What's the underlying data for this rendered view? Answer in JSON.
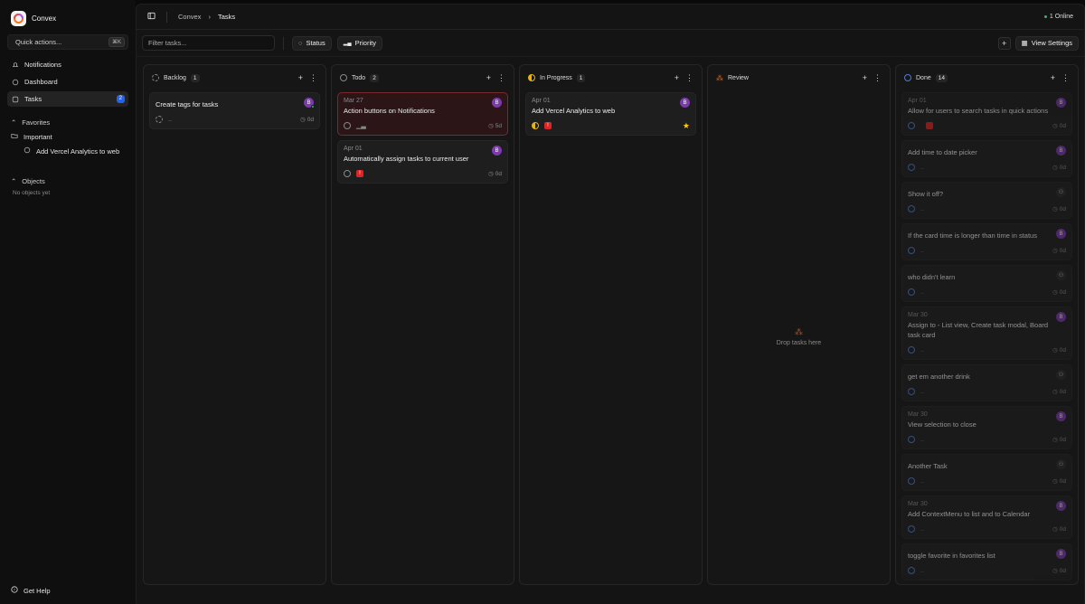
{
  "app": {
    "name": "Convex"
  },
  "sidebar": {
    "quick_actions": "Quick actions...",
    "quick_kbd": "⌘K",
    "nav": [
      {
        "label": "Notifications",
        "icon": "bell-icon"
      },
      {
        "label": "Dashboard",
        "icon": "dashboard-icon"
      },
      {
        "label": "Tasks",
        "icon": "tasks-icon",
        "badge": "2"
      }
    ],
    "favorites": {
      "label": "Favorites",
      "folder": "Important",
      "item": "Add Vercel Analytics to web"
    },
    "objects": {
      "label": "Objects",
      "empty": "No objects yet"
    },
    "help": "Get Help"
  },
  "topbar": {
    "crumb_root": "Convex",
    "crumb_current": "Tasks",
    "online": "1 Online"
  },
  "filterbar": {
    "placeholder": "Filter tasks...",
    "status": "Status",
    "priority": "Priority",
    "view_settings": "View Settings"
  },
  "columns": {
    "backlog": {
      "label": "Backlog",
      "count": "1"
    },
    "todo": {
      "label": "Todo",
      "count": "2"
    },
    "progress": {
      "label": "In Progress",
      "count": "1"
    },
    "review": {
      "label": "Review",
      "drop": "Drop tasks here"
    },
    "done": {
      "label": "Done",
      "count": "14"
    }
  },
  "cards": {
    "backlog": [
      {
        "title": "Create tags for tasks",
        "avatar": "B",
        "age": "0d"
      }
    ],
    "todo": [
      {
        "date": "Mar 27",
        "title": "Action buttons on Notifications",
        "avatar": "B",
        "age": "5d"
      },
      {
        "date": "Apr 01",
        "title": "Automatically assign tasks to current user",
        "avatar": "B",
        "age": "0d"
      }
    ],
    "progress": [
      {
        "date": "Apr 01",
        "title": "Add Vercel Analytics to web",
        "avatar": "B"
      }
    ],
    "done": [
      {
        "date": "Apr 01",
        "title": "Allow for users to search tasks in quick actions",
        "avatar": "B",
        "age": "0d"
      },
      {
        "date": "",
        "title": "Add time to date picker",
        "avatar": "B",
        "age": "0d"
      },
      {
        "date": "",
        "title": "Show it off?",
        "avatar": "",
        "age": "0d"
      },
      {
        "date": "",
        "title": "If the card time is longer than time in status",
        "avatar": "B",
        "age": "0d"
      },
      {
        "date": "",
        "title": "who didn't learn",
        "avatar": "",
        "age": "0d"
      },
      {
        "date": "Mar 30",
        "title": "Assign to - List view, Create task modal, Board task card",
        "avatar": "B",
        "age": "0d"
      },
      {
        "date": "",
        "title": "get em another drink",
        "avatar": "",
        "age": "0d"
      },
      {
        "date": "Mar 30",
        "title": "View selection to close",
        "avatar": "B",
        "age": "0d"
      },
      {
        "date": "",
        "title": "Another Task",
        "avatar": "",
        "age": "0d"
      },
      {
        "date": "Mar 30",
        "title": "Add ContextMenu to list and to Calendar",
        "avatar": "B",
        "age": "0d"
      },
      {
        "date": "",
        "title": "toggle favorite in favorites list",
        "avatar": "B",
        "age": "0d"
      }
    ]
  }
}
